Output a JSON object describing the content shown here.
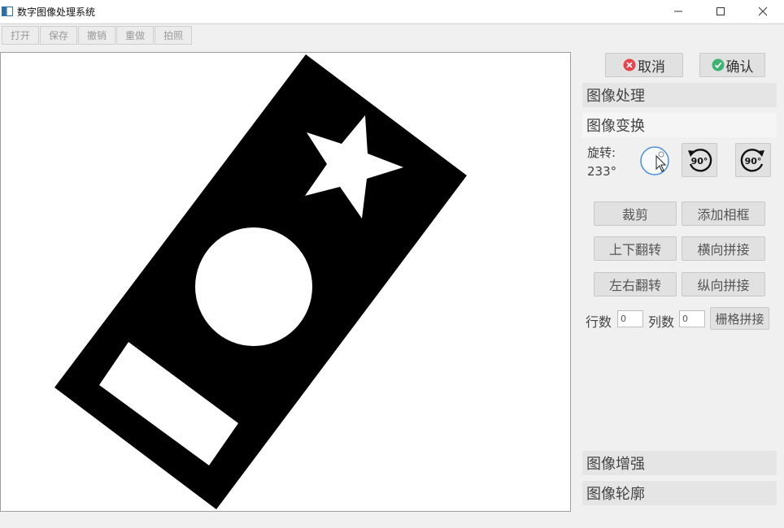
{
  "app": {
    "title": "数字图像处理系统"
  },
  "toolbar": {
    "items": [
      "打开",
      "保存",
      "撤销",
      "重做",
      "拍照"
    ]
  },
  "panel": {
    "cancel_label": "取消",
    "confirm_label": "确认",
    "sections": {
      "processing": "图像处理",
      "transform": "图像变换",
      "enhance": "图像增强",
      "contour": "图像轮廓"
    },
    "rotate": {
      "label": "旋转:",
      "value": "233°",
      "ccw_label": "90°",
      "cw_label": "90°"
    },
    "buttons": {
      "crop": "裁剪",
      "add_frame": "添加相框",
      "flip_vertical": "上下翻转",
      "horizontal_stitch": "横向拼接",
      "flip_horizontal": "左右翻转",
      "vertical_stitch": "纵向拼接",
      "grid_stitch": "栅格拼接"
    },
    "grid": {
      "rows_label": "行数",
      "rows_value": "0",
      "cols_label": "列数",
      "cols_value": "0"
    }
  },
  "colors": {
    "cancel": "#e8434a",
    "confirm": "#3cb371",
    "dial": "#4a90d9"
  },
  "icons": [
    "app-icon",
    "minimize-icon",
    "maximize-icon",
    "close-icon",
    "cancel-icon",
    "confirm-icon",
    "rotate-ccw-icon",
    "rotate-cw-icon",
    "rotation-dial-icon"
  ]
}
